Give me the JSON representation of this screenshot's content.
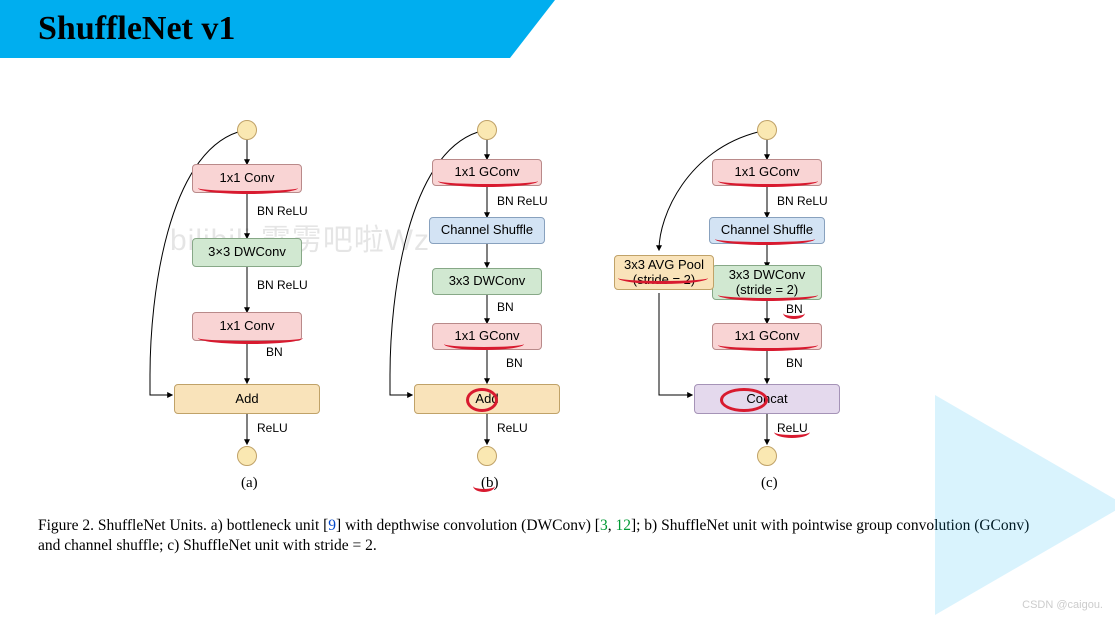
{
  "title": "ShuffleNet v1",
  "watermark": "bilibili  霹雳吧啦Wz",
  "credit": "CSDN @caigou.",
  "caption_prefix": "Figure 2. ShuffleNet Units. a) bottleneck unit [",
  "caption_ref1": "9",
  "caption_mid1": "] with depthwise convolution (DWConv) [",
  "caption_ref2": "3",
  "caption_comma": ", ",
  "caption_ref3": "12",
  "caption_suffix": "]; b) ShuffleNet unit with pointwise group convolution (GConv) and channel shuffle; c) ShuffleNet unit with stride = 2.",
  "labels": {
    "bn_relu": "BN ReLU",
    "bn": "BN",
    "relu": "ReLU",
    "sub_a": "(a)",
    "sub_b": "(b)",
    "sub_c": "(c)"
  },
  "boxes": {
    "a1": "1x1 Conv",
    "a2": "3×3 DWConv",
    "a3": "1x1 Conv",
    "a4": "Add",
    "b1": "1x1 GConv",
    "b2": "Channel Shuffle",
    "b3": "3x3 DWConv",
    "b4": "1x1 GConv",
    "b5": "Add",
    "c_pool": "3x3 AVG Pool\n(stride = 2)",
    "c1": "1x1 GConv",
    "c2": "Channel Shuffle",
    "c3": "3x3 DWConv\n(stride = 2)",
    "c4": "1x1 GConv",
    "c5": "Concat"
  }
}
